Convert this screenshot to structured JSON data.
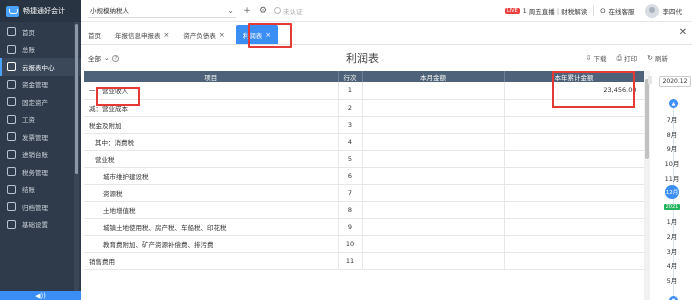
{
  "sidebar": {
    "logo_text": "畅捷通好会计",
    "items": [
      {
        "label": "首页",
        "icon": "home-icon"
      },
      {
        "label": "总账",
        "icon": "ledger-icon"
      },
      {
        "label": "云报表中心",
        "icon": "report-icon"
      },
      {
        "label": "资金管理",
        "icon": "fund-icon"
      },
      {
        "label": "固定资产",
        "icon": "asset-icon"
      },
      {
        "label": "工资",
        "icon": "salary-icon"
      },
      {
        "label": "发票管理",
        "icon": "invoice-icon"
      },
      {
        "label": "进销台账",
        "icon": "inventory-icon"
      },
      {
        "label": "税务管理",
        "icon": "tax-icon"
      },
      {
        "label": "结账",
        "icon": "close-icon"
      },
      {
        "label": "归档管理",
        "icon": "archive-icon"
      },
      {
        "label": "基础设置",
        "icon": "settings-icon"
      }
    ],
    "active_index": 2,
    "bottom_glyph": "◀))"
  },
  "topbar": {
    "company": "小规模纳税人",
    "company_arrow": "⌄",
    "add_glyph": "+",
    "settings_glyph": "⚙",
    "vip_text": "未认证",
    "live_badge": "LIVE",
    "message_count": "1",
    "live_text": "周五直播｜财税解读",
    "service_text": "在线客服",
    "user_name": "李四代"
  },
  "tabs": [
    {
      "label": "首页",
      "closable": false
    },
    {
      "label": "年报信息申报表",
      "closable": true
    },
    {
      "label": "资产负债表",
      "closable": true
    },
    {
      "label": "利润表",
      "closable": true,
      "active": true
    }
  ],
  "close_all_glyph": "✕",
  "report": {
    "period_label": "全部",
    "period_arrow": "⌄",
    "help_glyph": "?",
    "title": "利润表",
    "actions": [
      {
        "label": "下载",
        "icon": "download-icon",
        "glyph": "⇩"
      },
      {
        "label": "打印",
        "icon": "print-icon",
        "glyph": "⎙"
      },
      {
        "label": "刷新",
        "icon": "refresh-icon",
        "glyph": "↻"
      }
    ]
  },
  "table": {
    "headers": [
      "项目",
      "行次",
      "本月金额",
      "本年累计金额"
    ],
    "rows": [
      {
        "item": "一、营业收入",
        "line": "1",
        "month": "",
        "year": "23,456.00",
        "indent": 0
      },
      {
        "item": "减：营业成本",
        "line": "2",
        "month": "",
        "year": "",
        "indent": 0
      },
      {
        "item": "税金及附加",
        "line": "3",
        "month": "",
        "year": "",
        "indent": 0
      },
      {
        "item": "其中：消费税",
        "line": "4",
        "month": "",
        "year": "",
        "indent": 1
      },
      {
        "item": "营业税",
        "line": "5",
        "month": "",
        "year": "",
        "indent": 1
      },
      {
        "item": "城市维护建设税",
        "line": "6",
        "month": "",
        "year": "",
        "indent": 2
      },
      {
        "item": "资源税",
        "line": "7",
        "month": "",
        "year": "",
        "indent": 2
      },
      {
        "item": "土地增值税",
        "line": "8",
        "month": "",
        "year": "",
        "indent": 2
      },
      {
        "item": "城镇土地使用税、房产税、车船税、印花税",
        "line": "9",
        "month": "",
        "year": "",
        "indent": 2
      },
      {
        "item": "教育费附加、矿产资源补偿费、排污费",
        "line": "10",
        "month": "",
        "year": "",
        "indent": 2
      },
      {
        "item": "销售费用",
        "line": "11",
        "month": "",
        "year": "",
        "indent": 0
      }
    ]
  },
  "calendar": {
    "year": "2020.12",
    "year_badge": "2021",
    "up_glyph": "▲",
    "down_glyph": "▼",
    "months": [
      "7月",
      "8月",
      "9月",
      "10月",
      "11月",
      "12月",
      "2021",
      "1月",
      "2月",
      "3月",
      "4月",
      "5月"
    ],
    "current_index": 5,
    "year_index": 6
  }
}
